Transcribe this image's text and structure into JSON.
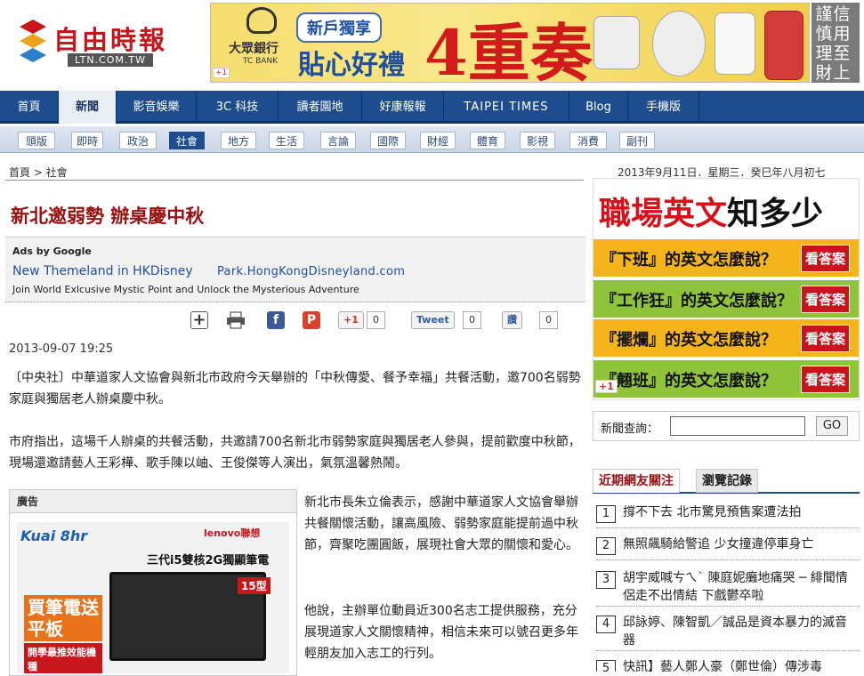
{
  "header": {
    "logo_text": "自由時報",
    "logo_sub": "LTN.COM.TW",
    "banner": {
      "bank_name": "大眾銀行",
      "bank_en": "TC BANK",
      "promo_label": "新戶獨享",
      "promo_main": "貼心好禮",
      "promo_big": "4重奏",
      "gplus": "+1"
    },
    "side_banner": [
      "謹慎理財",
      "信用至上"
    ]
  },
  "nav": {
    "main": [
      "首頁",
      "新聞",
      "影音娛樂",
      "3C 科技",
      "讀者園地",
      "好康報報",
      "TAIPEI TIMES",
      "Blog",
      "手機版"
    ],
    "active_main": 1,
    "sub": [
      "頭版",
      "即時",
      "政治",
      "社會",
      "地方",
      "生活",
      "言論",
      "國際",
      "財經",
      "體育",
      "影視",
      "消費",
      "副刊"
    ],
    "active_sub": 3
  },
  "breadcrumb": "首頁 > 社會",
  "date_line": "2013年9月11日．星期三．癸巳年八月初七",
  "article": {
    "title": "新北邀弱勢 辦桌慶中秋",
    "ads": {
      "by": "Ads by Google",
      "link": "New Themeland in HKDisney",
      "url": "Park.HongKongDisneyland.com",
      "desc": "Join World Exlcusive Mystic Point and Unlock the Mysterious Adventure"
    },
    "share": {
      "gplus": "+1",
      "gplus_count": "0",
      "tweet": "Tweet",
      "tweet_count": "0",
      "like": "讚",
      "like_count": "0"
    },
    "timestamp": "2013-09-07 19:25",
    "paragraphs": [
      "〔中央社〕中華道家人文協會與新北市政府今天舉辦的「中秋傳愛、餐予幸福」共餐活動，邀700名弱勢家庭與獨居老人辦桌慶中秋。",
      "市府指出，這場千人辦桌的共餐活動，共邀請700名新北市弱勢家庭與獨居老人參與，提前歡度中秋節，現場還邀請藝人王彩樺、歌手陳以岫、王俊傑等人演出，氣氛溫馨熱鬧。",
      "新北市長朱立倫表示，感謝中華道家人文協會舉辦共餐關懷活動，讓高風險、弱勢家庭能提前過中秋節，齊聚吃團圓飯，展現社會大眾的關懷和愛心。",
      "他說，主辦單位動員近300名志工提供服務，充分展現道家人文關懷精神，相信未來可以號召更多年輕朋友加入志工的行列。"
    ],
    "ad_block": {
      "heading": "廣告",
      "brand_left": "Kuai 8hr",
      "brand_right": "lenovo聯想",
      "product": "三代i5雙核2G獨顯筆電",
      "badge": "15型",
      "promo": "買筆電送平板",
      "promo_sub": "開學最推效能機種"
    }
  },
  "right": {
    "eng_ad": {
      "title_red": "職場英文",
      "title_black": "知多少",
      "rows": [
        {
          "q": "『下班』的英文怎麼說？",
          "btn": "看答案",
          "bg": "#f5b51a"
        },
        {
          "q": "『工作狂』的英文怎麼說？",
          "btn": "看答案",
          "bg": "#8fc43a"
        },
        {
          "q": "『擺爛』的英文怎麼說？",
          "btn": "看答案",
          "bg": "#f5b51a"
        },
        {
          "q": "『翹班』的英文怎麼說？",
          "btn": "看答案",
          "bg": "#8fc43a"
        }
      ],
      "gplus": "+1"
    },
    "search": {
      "label": "新聞查詢：",
      "go": "GO"
    },
    "tabs": [
      "近期網友關注",
      "瀏覽記錄"
    ],
    "ranking": [
      {
        "num": "1",
        "text": "撐不下去 北市驚見預售案遭法拍"
      },
      {
        "num": "2",
        "text": "無照飆騎給警追 少女撞違停車身亡"
      },
      {
        "num": "3",
        "text": "胡宇威喊ㄘㄟˋ 陳庭妮癱地痛哭 ─ 緋聞情侶走不出情結 下戲鬱卒啦"
      },
      {
        "num": "4",
        "text": "邱詠婷、陳智凱／誠品是資本暴力的滅音器"
      },
      {
        "num": "5",
        "text": "快訊】藝人鄭人豪（鄭世倫）傳涉毒"
      }
    ]
  },
  "colors": {
    "nav_bg": "#1d4d8e",
    "title_red": "#9a1010",
    "logo_red": "#c8161d"
  }
}
